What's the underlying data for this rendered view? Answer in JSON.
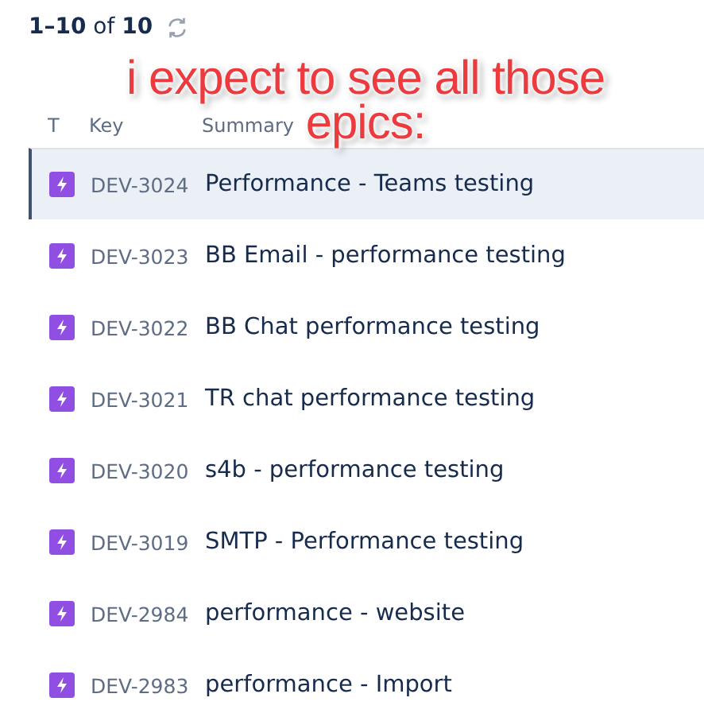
{
  "pagination": {
    "count": "**1–10** of **10**"
  },
  "annotation": {
    "lines": [
      "i expect to see all those",
      "epics:"
    ]
  },
  "table": {
    "columns": [
      "T",
      "Key",
      "Summary"
    ],
    "rows": [
      {
        "key": "DEV-3024",
        "summary": "Performance - Teams testing",
        "selected": true
      },
      {
        "key": "DEV-3023",
        "summary": "BB Email - performance testing",
        "selected": false
      },
      {
        "key": "DEV-3022",
        "summary": "BB Chat performance testing",
        "selected": false
      },
      {
        "key": "DEV-3021",
        "summary": "TR chat performance testing",
        "selected": false
      },
      {
        "key": "DEV-3020",
        "summary": "s4b - performance testing",
        "selected": false
      },
      {
        "key": "DEV-3019",
        "summary": "SMTP - Performance testing",
        "selected": false
      },
      {
        "key": "DEV-2984",
        "summary": "performance - website",
        "selected": false
      },
      {
        "key": "DEV-2983",
        "summary": "performance - Import",
        "selected": false
      }
    ]
  }
}
